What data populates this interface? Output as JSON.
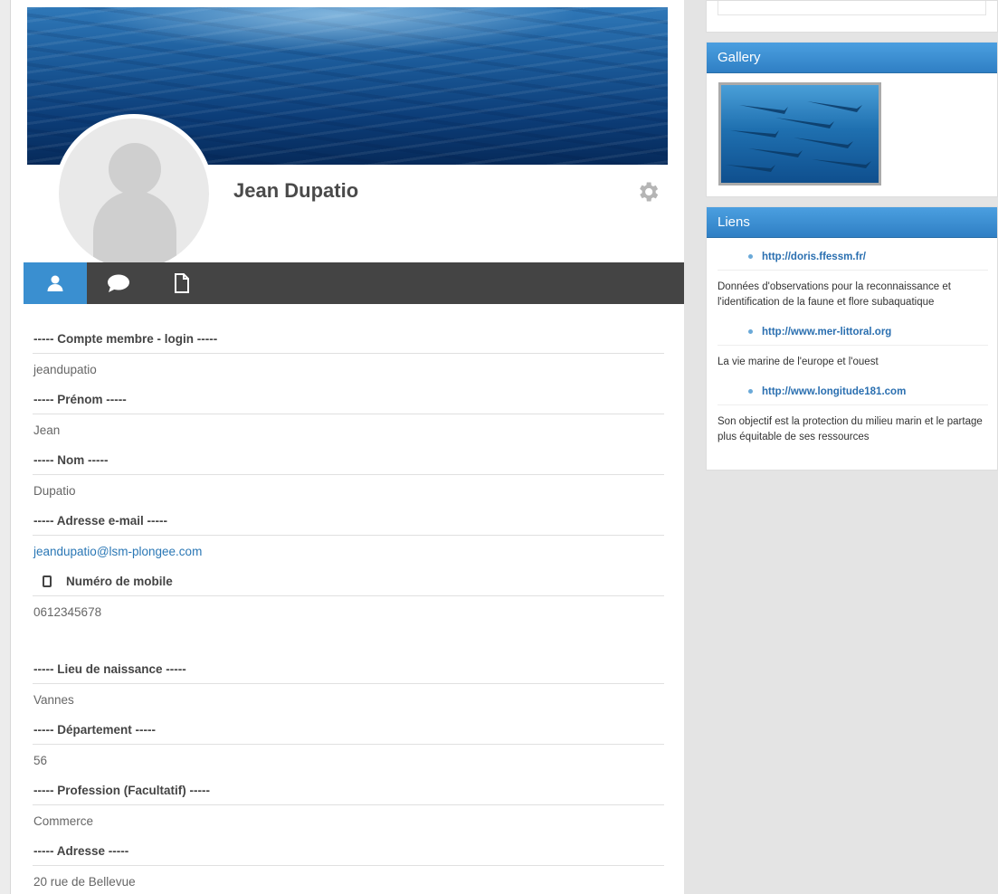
{
  "profile": {
    "name": "Jean Dupatio"
  },
  "tabs": [
    {
      "icon": "user-icon"
    },
    {
      "icon": "comment-icon"
    },
    {
      "icon": "file-icon"
    }
  ],
  "fields": [
    {
      "label": "----- Compte membre - login -----",
      "value": "jeandupatio"
    },
    {
      "label": "----- Prénom -----",
      "value": "Jean"
    },
    {
      "label": "----- Nom -----",
      "value": "Dupatio"
    },
    {
      "label": "----- Adresse e-mail -----",
      "value": "jeandupatio@lsm-plongee.com"
    },
    {
      "label": "Numéro de mobile",
      "value": "0612345678"
    },
    {
      "label": "----- Lieu de naissance -----",
      "value": "Vannes"
    },
    {
      "label": "----- Département -----",
      "value": "56"
    },
    {
      "label": "----- Profession (Facultatif) -----",
      "value": "Commerce"
    },
    {
      "label": "----- Adresse -----",
      "value": "20 rue de Bellevue"
    }
  ],
  "sidebar": {
    "gallery_title": "Gallery",
    "links_title": "Liens",
    "links": [
      {
        "url": "http://doris.ffessm.fr/",
        "desc": "Données d'observations pour la reconnaissance et l'identification de la faune et flore subaquatique"
      },
      {
        "url": "http://www.mer-littoral.org",
        "desc": "La vie marine de l'europe et l'ouest"
      },
      {
        "url": "http://www.longitude181.com",
        "desc": "Son objectif est la protection du milieu marin et le partage plus équitable de ses ressources"
      }
    ]
  },
  "colors": {
    "accent": "#3a8fd0",
    "tabbar": "#444444",
    "link": "#2a77b5"
  }
}
